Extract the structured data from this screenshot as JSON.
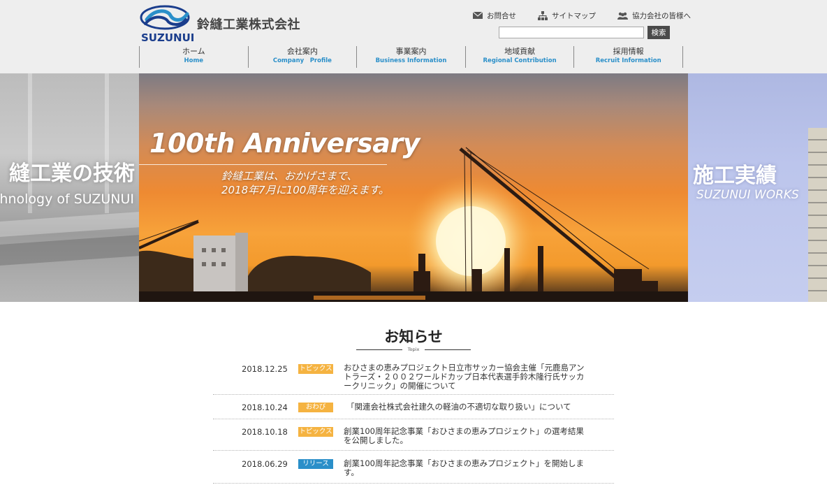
{
  "colors": {
    "header_bg": "#eeeeee",
    "nav_en": "#2a8fc9",
    "brand_blue": "#1a3d8c",
    "badge_topics": "#f5b341",
    "badge_apology": "#f5b341",
    "badge_release": "#2a8fc9"
  },
  "header": {
    "logo_en": "SUZUNUI",
    "logo_jp": "鈴縫工業株式会社",
    "util_links": {
      "contact": "お問合せ",
      "sitemap": "サイトマップ",
      "partners": "協力会社の皆様へ"
    },
    "search": {
      "value": "",
      "placeholder": "",
      "button": "検索"
    }
  },
  "nav": [
    {
      "jp": "ホーム",
      "en": "Home"
    },
    {
      "jp": "会社案内",
      "en": "Company　Profile"
    },
    {
      "jp": "事業案内",
      "en": "Business Information"
    },
    {
      "jp": "地域貢献",
      "en": "Regional Contribution"
    },
    {
      "jp": "採用情報",
      "en": "Recruit Information"
    }
  ],
  "hero": {
    "left_jp": "縫工業の技術",
    "left_en": "chnology of SUZUNUI",
    "title": "100th Anniversary",
    "sub_line1": "鈴縫工業は、おかげさまで、",
    "sub_line2": "2018年7月に100周年を迎えます。",
    "right_jp": "施工実績",
    "right_en": "SUZUNUI WORKS"
  },
  "news": {
    "title": "お知らせ",
    "subtitle": "Topix",
    "items": [
      {
        "date": "2018.12.25",
        "badge": "トピックス",
        "badge_type": "topics",
        "text": "おひさまの恵みプロジェクト日立市サッカー協会主催「元鹿島アントラーズ・２００２ワールドカップ日本代表選手鈴木隆行氏サッカークリニック」の開催について"
      },
      {
        "date": "2018.10.24",
        "badge": "おわび",
        "badge_type": "apology",
        "text": "「関連会社株式会社建久の軽油の不適切な取り扱い」について"
      },
      {
        "date": "2018.10.18",
        "badge": "トピックス",
        "badge_type": "topics",
        "text": "創業100周年記念事業「おひさまの恵みプロジェクト」の選考結果を公開しました。"
      },
      {
        "date": "2018.06.29",
        "badge": "リリース",
        "badge_type": "release",
        "text": "創業100周年記念事業「おひさまの恵みプロジェクト」を開始します。"
      }
    ]
  }
}
